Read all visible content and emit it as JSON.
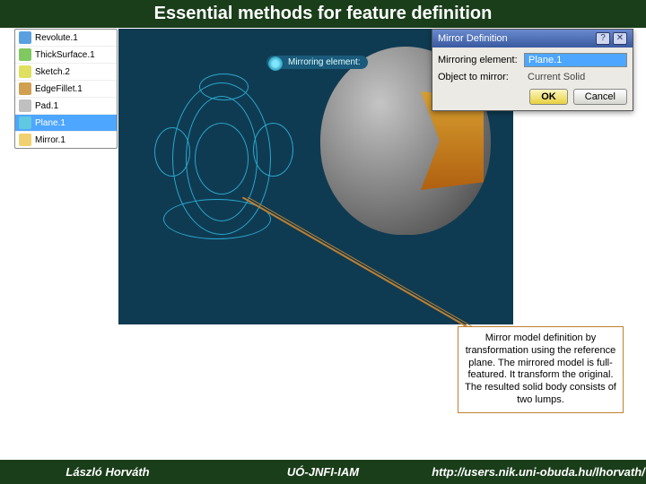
{
  "header": {
    "title": "Essential methods for feature definition"
  },
  "tree": {
    "items": [
      {
        "label": "Revolute.1",
        "color": "#5aa0e0"
      },
      {
        "label": "ThickSurface.1",
        "color": "#80c860"
      },
      {
        "label": "Sketch.2",
        "color": "#e0e060"
      },
      {
        "label": "EdgeFillet.1",
        "color": "#d0a050"
      },
      {
        "label": "Pad.1",
        "color": "#c0c0c0"
      },
      {
        "label": "Plane.1",
        "color": "#60c8e0",
        "selected": true
      },
      {
        "label": "Mirror.1",
        "color": "#f0d070"
      }
    ]
  },
  "viewport": {
    "tag_label": "Mirroring element:",
    "callout_text": "Mirror model definition by transformation using the reference plane. The mirrored model is full-featured. It transform the original. The resulted solid body consists of two lumps."
  },
  "dialog": {
    "title": "Mirror Definition",
    "help": "?",
    "close": "✕",
    "rows": [
      {
        "label": "Mirroring element:",
        "value": "Plane.1",
        "selected": true
      },
      {
        "label": "Object to mirror:",
        "value": "Current Solid",
        "readonly": true
      }
    ],
    "ok": "OK",
    "cancel": "Cancel"
  },
  "footer": {
    "author": "László Horváth",
    "org": "UÓ-JNFI-IAM",
    "url": "http://users.nik.uni-obuda.hu/lhorvath/"
  }
}
